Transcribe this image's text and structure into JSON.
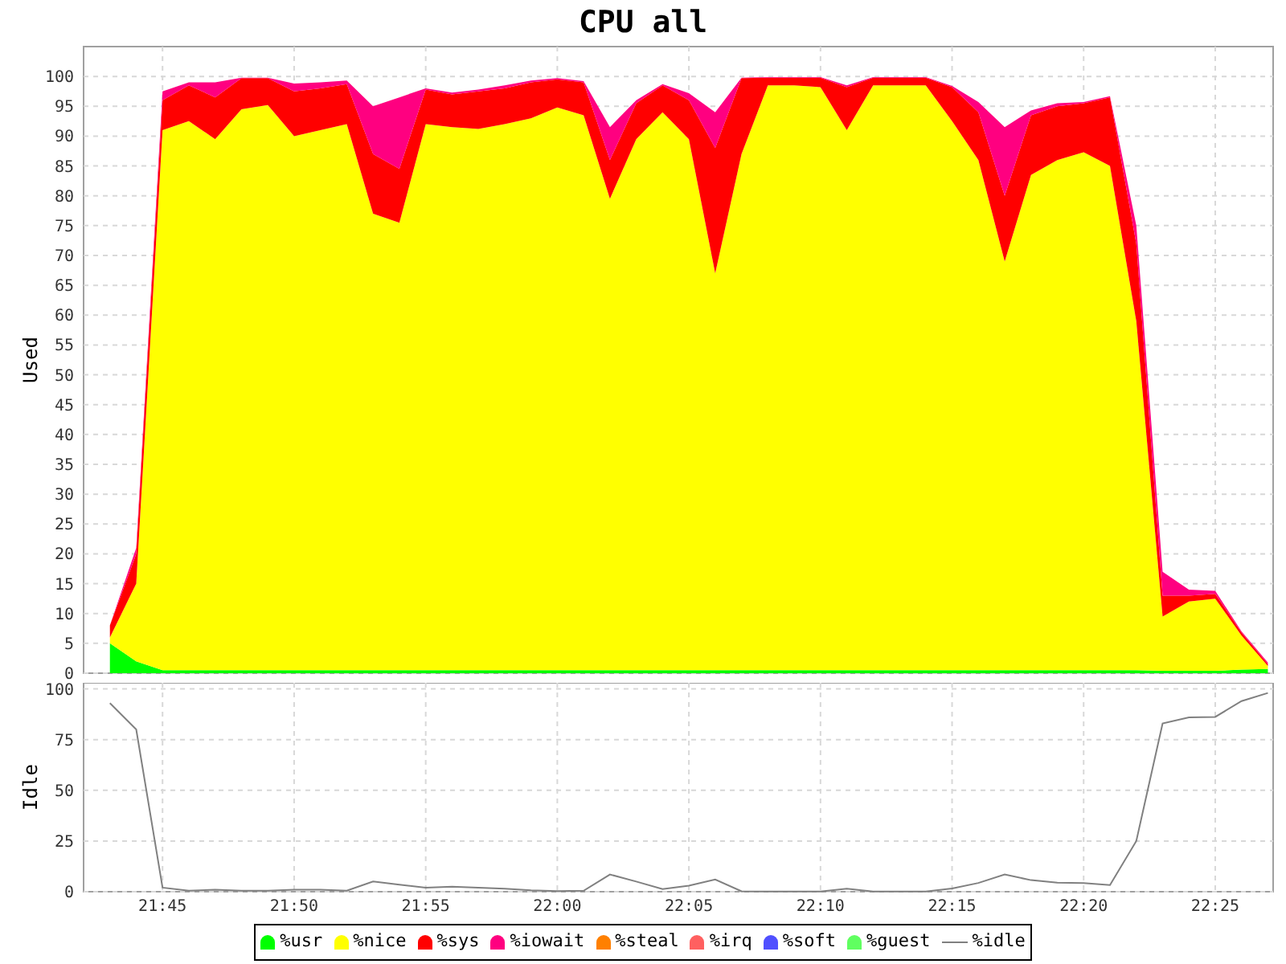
{
  "title": "CPU all",
  "charts": [
    {
      "chart_data": {
        "type": "area",
        "stacked": true,
        "grid": true,
        "ylabel": "Used",
        "ylim": [
          0,
          105
        ],
        "yticks": [
          0,
          5,
          10,
          15,
          20,
          25,
          30,
          35,
          40,
          45,
          50,
          55,
          60,
          65,
          70,
          75,
          80,
          85,
          90,
          95,
          100
        ],
        "xlim": [
          1302,
          1347.2
        ],
        "x": [
          1303,
          1304,
          1305,
          1306,
          1307,
          1308,
          1309,
          1310,
          1311,
          1312,
          1313,
          1314,
          1315,
          1316,
          1317,
          1318,
          1319,
          1320,
          1321,
          1322,
          1323,
          1324,
          1325,
          1326,
          1327,
          1328,
          1329,
          1330,
          1331,
          1332,
          1333,
          1334,
          1335,
          1336,
          1337,
          1338,
          1339,
          1340,
          1341,
          1342,
          1343,
          1344,
          1345,
          1346,
          1347
        ],
        "series": [
          {
            "color": "#00ff00",
            "values": [
              5,
              2,
              0.5,
              0.5,
              0.5,
              0.5,
              0.5,
              0.5,
              0.5,
              0.5,
              0.5,
              0.5,
              0.5,
              0.5,
              0.5,
              0.5,
              0.5,
              0.5,
              0.5,
              0.5,
              0.5,
              0.5,
              0.5,
              0.5,
              0.5,
              0.5,
              0.5,
              0.5,
              0.5,
              0.5,
              0.5,
              0.5,
              0.5,
              0.5,
              0.5,
              0.5,
              0.5,
              0.5,
              0.5,
              0.5,
              0.4,
              0.4,
              0.4,
              0.6,
              0.7
            ]
          },
          {
            "color": "#ffff00",
            "values": [
              1,
              13,
              90.5,
              92,
              89,
              94,
              94.7,
              89.5,
              90.5,
              91.5,
              76.5,
              75,
              91.5,
              91,
              90.7,
              91.5,
              92.5,
              94.3,
              93,
              79,
              89,
              93.5,
              89,
              66.5,
              86.5,
              98,
              98,
              97.7,
              90.5,
              98,
              98,
              98,
              92,
              85.5,
              68.5,
              83,
              85.5,
              86.8,
              84.5,
              58.5,
              9.1,
              11.6,
              12.1,
              5.7,
              0.5
            ]
          },
          {
            "color": "#ff0000",
            "values": [
              2,
              5,
              5,
              6,
              7,
              5.2,
              4.5,
              7.5,
              7,
              6.7,
              10,
              9,
              5.8,
              5.5,
              6.3,
              6,
              6,
              4.7,
              5.5,
              6.5,
              6,
              4.5,
              6.5,
              21,
              12.7,
              1.3,
              1.3,
              1.6,
              7.2,
              1.3,
              1.3,
              1.3,
              5.7,
              8,
              11,
              10,
              9,
              8.2,
              11.5,
              13,
              3.5,
              1,
              0.8,
              0.5,
              0.3
            ]
          },
          {
            "color": "#ff0080",
            "values": [
              0,
              1,
              1.5,
              0.5,
              2.5,
              0.1,
              0.1,
              1.3,
              1,
              0.6,
              8,
              12,
              0.2,
              0.3,
              0.3,
              0.5,
              0.3,
              0.2,
              0.2,
              5.5,
              0.5,
              0.2,
              1.2,
              6,
              0.1,
              0.1,
              0.1,
              0.1,
              0.3,
              0.1,
              0.1,
              0.1,
              0.2,
              1.7,
              11.5,
              0.8,
              0.5,
              0.2,
              0.2,
              3,
              4,
              1,
              0.5,
              0.2,
              0.3
            ]
          }
        ]
      }
    },
    {
      "chart_data": {
        "type": "line",
        "grid": true,
        "ylabel": "Idle",
        "ylim": [
          0,
          103
        ],
        "yticks": [
          0,
          25,
          50,
          75,
          100
        ],
        "xlim": [
          1302,
          1347.2
        ],
        "x": [
          1303,
          1304,
          1305,
          1306,
          1307,
          1308,
          1309,
          1310,
          1311,
          1312,
          1313,
          1314,
          1315,
          1316,
          1317,
          1318,
          1319,
          1320,
          1321,
          1322,
          1323,
          1324,
          1325,
          1326,
          1327,
          1328,
          1329,
          1330,
          1331,
          1332,
          1333,
          1334,
          1335,
          1336,
          1337,
          1338,
          1339,
          1340,
          1341,
          1342,
          1343,
          1344,
          1345,
          1346,
          1347
        ],
        "xticks": [
          {
            "value": 1305,
            "label": "21:45"
          },
          {
            "value": 1310,
            "label": "21:50"
          },
          {
            "value": 1315,
            "label": "21:55"
          },
          {
            "value": 1320,
            "label": "22:00"
          },
          {
            "value": 1325,
            "label": "22:05"
          },
          {
            "value": 1330,
            "label": "22:10"
          },
          {
            "value": 1335,
            "label": "22:15"
          },
          {
            "value": 1340,
            "label": "22:20"
          },
          {
            "value": 1345,
            "label": "22:25"
          }
        ],
        "series": [
          {
            "color": "#808080",
            "values": [
              93,
              80,
              2,
              0.5,
              1,
              0.5,
              0.5,
              1,
              1,
              0.5,
              5,
              3.5,
              2,
              2.5,
              2,
              1.5,
              0.7,
              0.3,
              0.5,
              8.5,
              5,
              1.3,
              3,
              6,
              0.2,
              0.1,
              0.1,
              0.1,
              1.5,
              0.1,
              0.1,
              0.1,
              1.6,
              4.3,
              8.5,
              5.7,
              4.5,
              4.3,
              3.3,
              25,
              83,
              86,
              86.2,
              94,
              98
            ]
          }
        ]
      }
    }
  ],
  "legend": [
    {
      "label": "%usr",
      "color": "#00ff00",
      "kind": "area"
    },
    {
      "label": "%nice",
      "color": "#ffff00",
      "kind": "area"
    },
    {
      "label": "%sys",
      "color": "#ff0000",
      "kind": "area"
    },
    {
      "label": "%iowait",
      "color": "#ff0080",
      "kind": "area"
    },
    {
      "label": "%steal",
      "color": "#ff8000",
      "kind": "area"
    },
    {
      "label": "%irq",
      "color": "#ff6060",
      "kind": "area"
    },
    {
      "label": "%soft",
      "color": "#5050ff",
      "kind": "area"
    },
    {
      "label": "%guest",
      "color": "#60ff60",
      "kind": "area"
    },
    {
      "label": "%idle",
      "color": "#808080",
      "kind": "line"
    }
  ]
}
